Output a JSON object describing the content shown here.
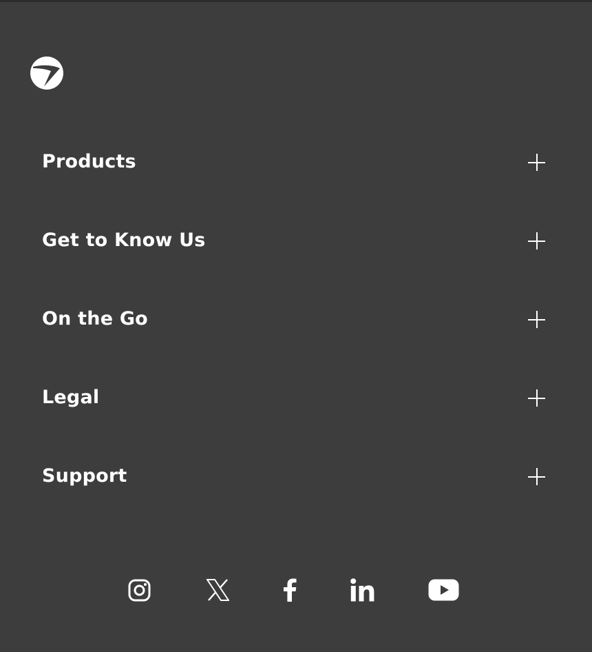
{
  "footer": {
    "brand": {
      "logo_icon": "brand-swoosh-circle-logo"
    },
    "sections": [
      {
        "label": "Products",
        "icon": "plus-icon"
      },
      {
        "label": "Get to Know Us",
        "icon": "plus-icon"
      },
      {
        "label": "On the Go",
        "icon": "plus-icon"
      },
      {
        "label": "Legal",
        "icon": "plus-icon"
      },
      {
        "label": "Support",
        "icon": "plus-icon"
      }
    ],
    "social": [
      {
        "icon": "instagram-icon"
      },
      {
        "icon": "x-twitter-icon"
      },
      {
        "icon": "facebook-icon"
      },
      {
        "icon": "linkedin-icon"
      },
      {
        "icon": "youtube-icon"
      }
    ]
  },
  "colors": {
    "background": "#3d3d3d",
    "top_rule": "#2c2c2c",
    "foreground": "#ffffff"
  }
}
